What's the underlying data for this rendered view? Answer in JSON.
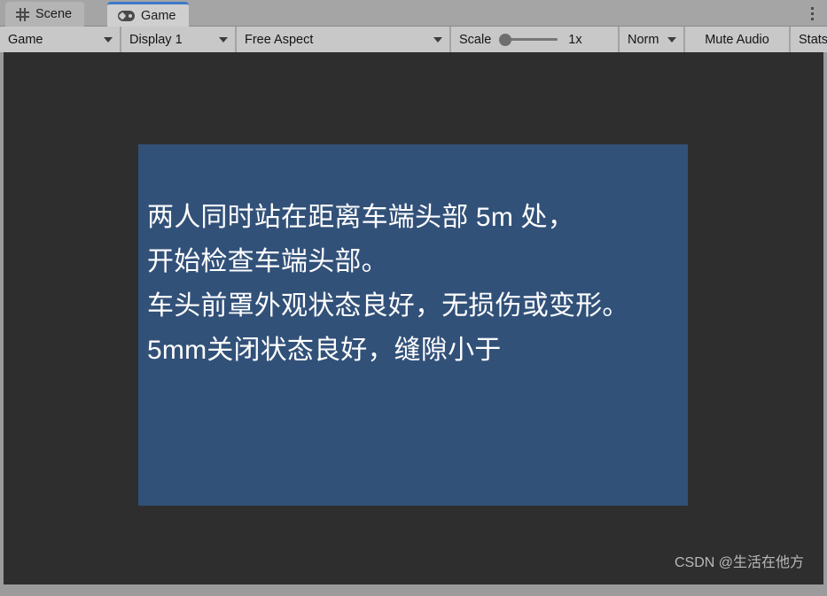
{
  "window": {
    "tabs": [
      {
        "label": "Scene",
        "icon": "grid-icon",
        "active": false
      },
      {
        "label": "Game",
        "icon": "gamepad-icon",
        "active": true
      }
    ],
    "menu_icon": "kebab-menu-icon"
  },
  "toolbar": {
    "game_target": "Game",
    "display": "Display 1",
    "aspect": "Free Aspect",
    "scale_label": "Scale",
    "scale_value": "1x",
    "render_mode": "Norm ",
    "mute_audio": "Mute Audio",
    "stats": "Stats",
    "caret_icon": "chevron-down-icon"
  },
  "game_view": {
    "background_color": "#2e2e2e",
    "panel_color": "#325179",
    "text_color": "#ffffff",
    "text_block_primary": "两人同时站在距离车端头部 5m 处，\n开始检查车端头部。\n车头前罩外观状态良好，无损伤或变形。",
    "text_block_overlay": "5mm关闭状态良好，缝隙小于"
  },
  "watermark": {
    "text": "CSDN @生活在他方"
  }
}
